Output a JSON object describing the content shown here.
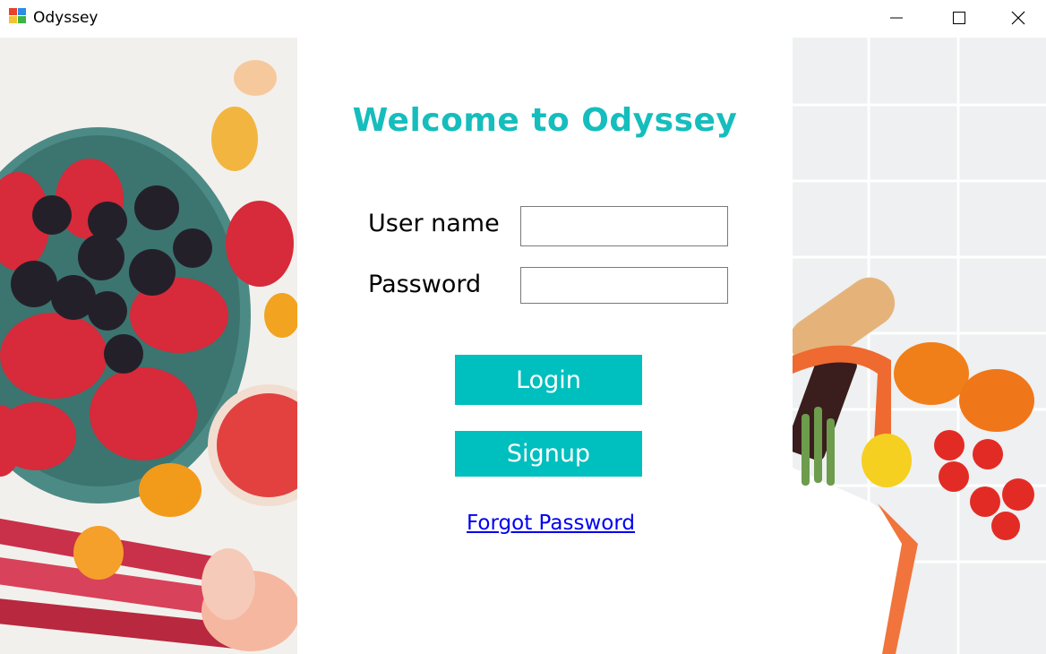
{
  "window": {
    "title": "Odyssey",
    "icon": "app-window-icon",
    "controls": [
      "minimize-icon",
      "maximize-icon",
      "close-icon"
    ]
  },
  "login": {
    "welcome_text": "Welcome to Odyssey",
    "username_label": "User name",
    "username_value": "",
    "password_label": "Password",
    "password_value": "",
    "login_button": "Login",
    "signup_button": "Signup",
    "forgot_password_link": "Forgot Password"
  },
  "colors": {
    "accent": "#00bfbf",
    "title": "#16bdbd",
    "link": "#0000ee"
  }
}
